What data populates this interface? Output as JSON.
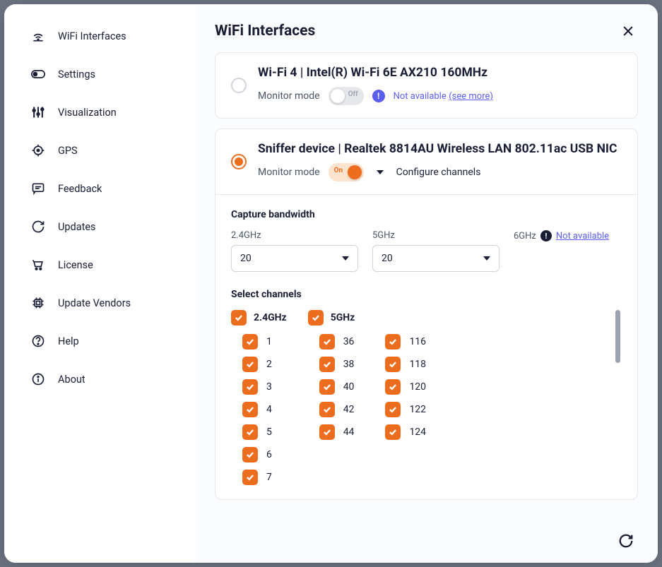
{
  "sidebar": {
    "items": [
      {
        "label": "WiFi Interfaces",
        "icon": "wifi"
      },
      {
        "label": "Settings",
        "icon": "toggle"
      },
      {
        "label": "Visualization",
        "icon": "sliders"
      },
      {
        "label": "GPS",
        "icon": "target"
      },
      {
        "label": "Feedback",
        "icon": "comment"
      },
      {
        "label": "Updates",
        "icon": "refresh"
      },
      {
        "label": "License",
        "icon": "cart"
      },
      {
        "label": "Update Vendors",
        "icon": "chip"
      },
      {
        "label": "Help",
        "icon": "help"
      },
      {
        "label": "About",
        "icon": "info"
      }
    ]
  },
  "header": {
    "title": "WiFi Interfaces"
  },
  "interfaces": [
    {
      "title": "Wi-Fi 4 | Intel(R) Wi-Fi 6E AX210 160MHz",
      "monitorLabel": "Monitor mode",
      "toggle": "Off",
      "notAvailable": "Not available",
      "seeMore": "(see more)",
      "selected": false
    },
    {
      "title": "Sniffer device | Realtek 8814AU Wireless LAN 802.11ac USB NIC",
      "monitorLabel": "Monitor mode",
      "toggle": "On",
      "configureLabel": "Configure channels",
      "selected": true
    }
  ],
  "bandwidth": {
    "sectionTitle": "Capture bandwidth",
    "cols": [
      {
        "label": "2.4GHz",
        "value": "20"
      },
      {
        "label": "5GHz",
        "value": "20"
      }
    ],
    "sixg": {
      "label": "6GHz",
      "notAvailable": "Not available"
    }
  },
  "channels": {
    "sectionTitle": "Select channels",
    "bands": [
      {
        "label": "2.4GHz",
        "cols": [
          [
            "1",
            "2",
            "3",
            "4",
            "5",
            "6",
            "7"
          ]
        ]
      },
      {
        "label": "5GHz",
        "cols": [
          [
            "36",
            "38",
            "40",
            "42",
            "44"
          ],
          [
            "116",
            "118",
            "120",
            "122",
            "124"
          ]
        ]
      }
    ]
  }
}
